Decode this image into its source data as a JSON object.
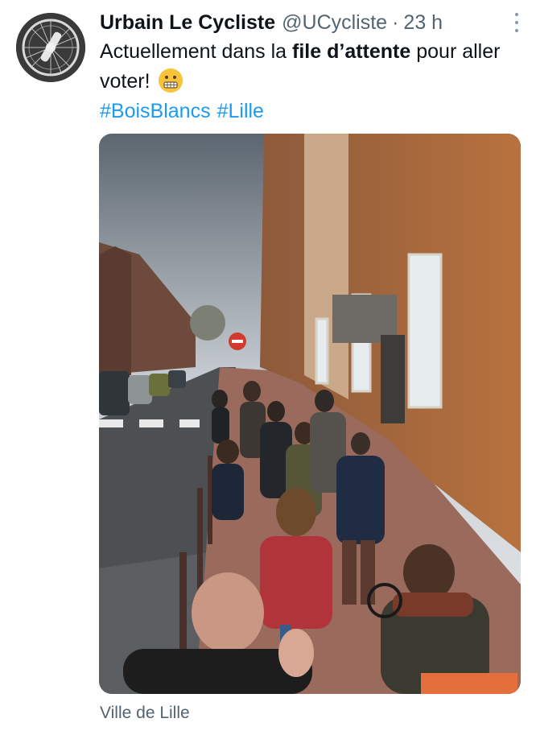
{
  "author": {
    "name": "Urbain Le Cycliste",
    "handle": "@UCycliste",
    "separator": "·",
    "time": "23 h",
    "avatar_icon": "bicycle-wheel-avatar-icon"
  },
  "tweet": {
    "text_before": "Actuellement dans la ",
    "text_bold": "file d’attente",
    "text_after": " pour aller voter!",
    "emoji_icon": "grimacing-face-emoji",
    "hashtags": [
      "#BoisBlancs",
      "#Lille"
    ]
  },
  "media": {
    "type": "photo"
  },
  "location": "Ville de Lille",
  "colors": {
    "link": "#1d9bf0",
    "secondary_text": "#536471",
    "primary_text": "#0f1419"
  }
}
